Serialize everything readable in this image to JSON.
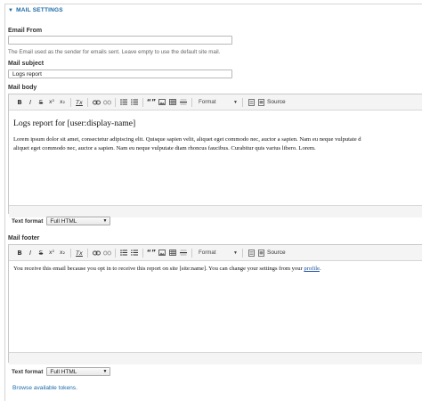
{
  "section": {
    "title": "MAIL SETTINGS"
  },
  "email_from": {
    "label": "Email From",
    "value": "",
    "description": "The Email used as the sender for emails sent. Leave empty to use the default site mail."
  },
  "mail_subject": {
    "label": "Mail subject",
    "value": "Logs report"
  },
  "mail_body": {
    "label": "Mail body",
    "heading": "Logs report for [user:display-name]",
    "line1": "Lorem ipsum dolor sit amet, consectetur adipiscing elit. Quisque sapien velit, aliquet eget commodo nec, auctor a sapien. Nam eu neque vulputate d",
    "line2": "aliquet eget commodo nec, auctor a sapien. Nam eu neque vulputate diam rhoncus faucibus. Curabitur quis varius libero. Lorem."
  },
  "mail_footer": {
    "label": "Mail footer",
    "text": "You receive this email because you opt in to receive this report on site [site:name]. You can change your settings from your ",
    "link_text": "profile",
    "after_link": "."
  },
  "toolbar": {
    "bold": "B",
    "italic": "I",
    "strike": "S",
    "superscript": "x²",
    "subscript": "x₂",
    "remove_format": "Tx",
    "blockquote": "“”",
    "format_label": "Format",
    "source_label": "Source"
  },
  "text_format": {
    "label": "Text format",
    "selected": "Full HTML"
  },
  "tokens_link": "Browse available tokens."
}
